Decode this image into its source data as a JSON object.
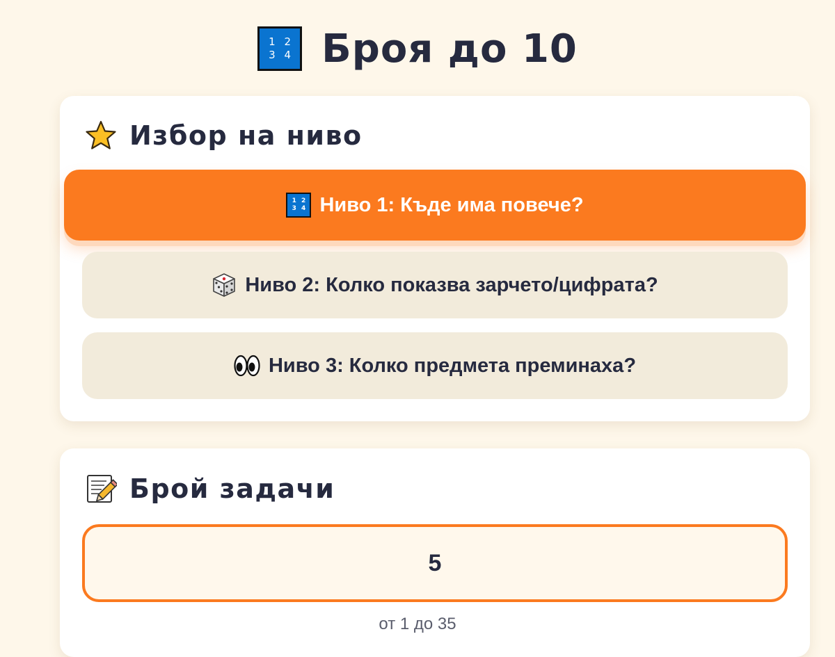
{
  "header": {
    "title_icon": "input-numbers-keycap-icon",
    "title_icon_digits": [
      "1 2",
      "3 4"
    ],
    "title": "Броя до 10"
  },
  "level_section": {
    "icon": "star-icon",
    "heading": "Избор на ниво",
    "levels": [
      {
        "icon": "input-numbers-keycap-icon",
        "label": "Ниво 1: Къде има повече?",
        "selected": true
      },
      {
        "icon": "dice-icon",
        "label": "Ниво 2: Колко показва зарчето/цифрата?",
        "selected": false
      },
      {
        "icon": "eyes-icon",
        "label": "Ниво 3: Колко предмета преминаха?",
        "selected": false
      }
    ]
  },
  "task_section": {
    "icon": "memo-pencil-icon",
    "heading": "Брой задачи",
    "count_value": "5",
    "range_hint": "от 1 до 35"
  },
  "colors": {
    "background": "#fef7ea",
    "accent": "#fb7a1f",
    "text": "#262a3f",
    "idle_button": "#f2ebdb",
    "keycap_blue": "#0a74d0"
  }
}
